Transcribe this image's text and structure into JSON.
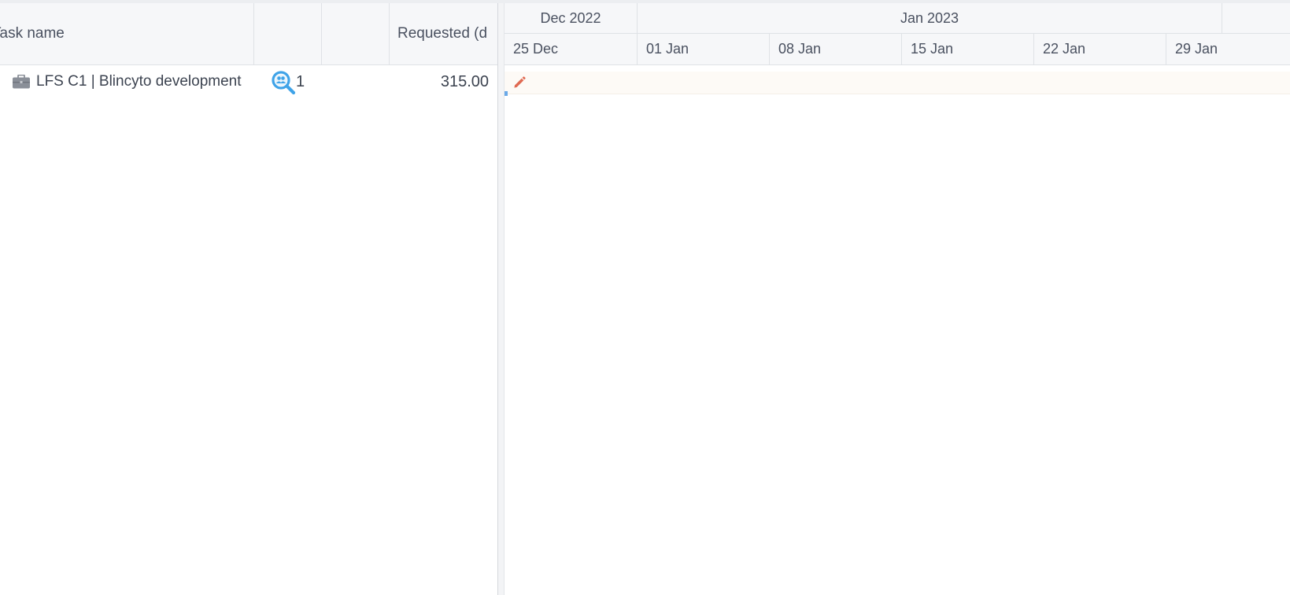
{
  "grid": {
    "columns": {
      "task_name": "Task name",
      "col_a": "",
      "col_b": "",
      "requested": "Requested (d"
    },
    "rows": [
      {
        "icon": "briefcase-icon",
        "name": "LFS C1 | Blincyto development",
        "resource_icon": "resource-search-icon",
        "count": "1",
        "requested": "315.00"
      }
    ]
  },
  "timeline": {
    "months": [
      "Dec 2022",
      "Jan 2023",
      ""
    ],
    "weeks": [
      "25 Dec",
      "01 Jan",
      "08 Jan",
      "15 Jan",
      "22 Jan",
      "29 Jan"
    ],
    "row_icon": "pencil-icon"
  },
  "colors": {
    "header_bg": "#f6f7f9",
    "border": "#dfe2e6",
    "text": "#3c4350",
    "search_icon": "#3fa3e8",
    "pencil_icon": "#e06a52",
    "row_highlight": "#fdfaf6"
  }
}
